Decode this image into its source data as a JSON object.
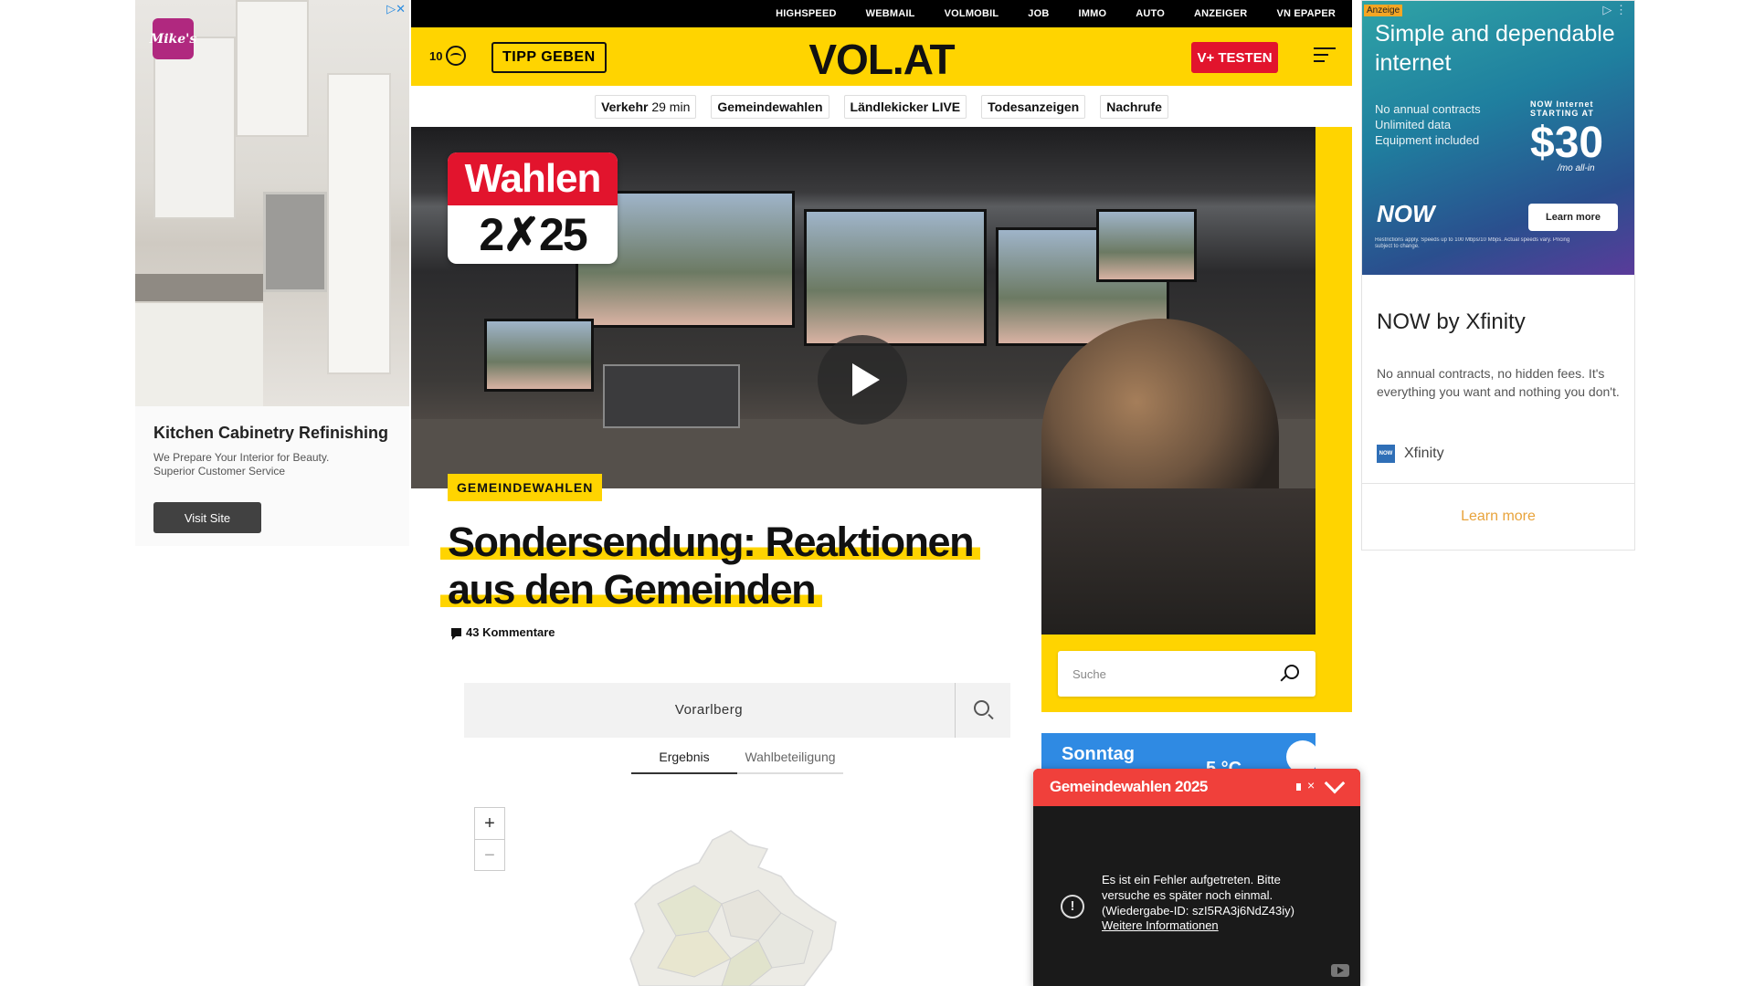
{
  "left_ad": {
    "logo_text": "Mike's",
    "title": "Kitchen Cabinetry Refinishing",
    "desc_line1": "We Prepare Your Interior for Beauty.",
    "desc_line2": "Superior Customer Service",
    "button": "Visit Site",
    "adchoice": "▷✕"
  },
  "topnav": [
    "HIGHSPEED",
    "WEBMAIL",
    "VOLMOBIL",
    "JOB",
    "IMMO",
    "AUTO",
    "ANZEIGER",
    "VN EPAPER"
  ],
  "header": {
    "temperature": "10",
    "tipp": "TIPP GEBEN",
    "logo": "VOL.AT",
    "vplus": "V+ TESTEN"
  },
  "quicklinks": [
    {
      "label": "Verkehr",
      "sub": "29 min"
    },
    {
      "label": "Gemeindewahlen",
      "sub": ""
    },
    {
      "label": "Ländlekicker LIVE",
      "sub": ""
    },
    {
      "label": "Todesanzeigen",
      "sub": ""
    },
    {
      "label": "Nachrufe",
      "sub": ""
    }
  ],
  "hero": {
    "wahlen_line1": "Wahlen",
    "wahlen_line2": "2✗25"
  },
  "article": {
    "category": "GEMEINDEWAHLEN",
    "headline_line1": "Sondersendung: Reaktionen",
    "headline_line2": "aus den Gemeinden",
    "comments": "43 Kommentare"
  },
  "search": {
    "placeholder": "Suche"
  },
  "election_widget": {
    "region": "Vorarlberg",
    "tabs": [
      "Ergebnis",
      "Wahlbeteiligung"
    ],
    "zoom_in": "+",
    "zoom_out": "−"
  },
  "weather": {
    "day": "Sonntag",
    "temp": "5 °C"
  },
  "right_ad": {
    "label": "Anzeige",
    "adchoice": "▷ ⋮",
    "banner_title": "Simple and dependable internet",
    "features": [
      "No annual contracts",
      "Unlimited data",
      "Equipment included"
    ],
    "price_label_1": "NOW Internet",
    "price_label_2": "STARTING AT",
    "price": "$30",
    "price_sub": "/mo all-in",
    "logo": "NOW",
    "banner_button": "Learn more",
    "fine_print": "Restrictions apply. Speeds up to 100 Mbps/10 Mbps. Actual speeds vary. Pricing subject to change.",
    "title": "NOW by Xfinity",
    "desc": "No annual contracts, no hidden fees. It's everything you want and nothing you don't.",
    "brand_icon": "NOW",
    "brand": "Xfinity",
    "learn_more": "Learn more"
  },
  "video_popup": {
    "title": "Gemeindewahlen 2025",
    "error_line1": "Es ist ein Fehler aufgetreten. Bitte",
    "error_line2": "versuche es später noch einmal.",
    "error_line3": "(Wiedergabe-ID: szI5RA3j6NdZ43iy)",
    "link": "Weitere Informationen",
    "error_icon": "!"
  },
  "colors": {
    "brand_yellow": "#ffd400",
    "vplus_red": "#e2142d",
    "popup_red": "#f0403b",
    "weather_blue": "#2f8ae3",
    "ad_link_orange": "#e8a33b"
  }
}
